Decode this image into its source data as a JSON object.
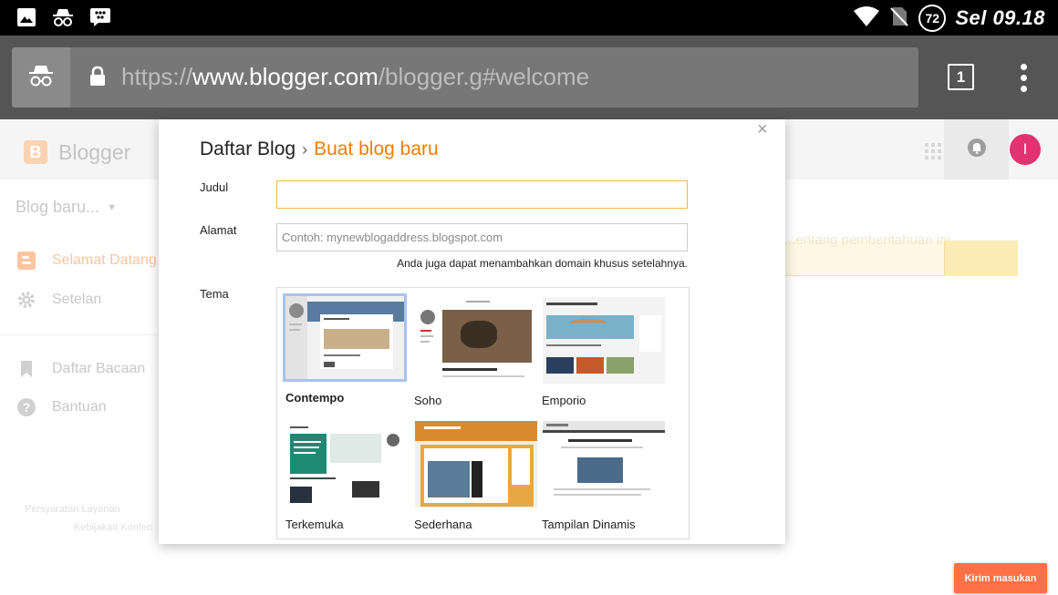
{
  "status_bar": {
    "battery": "72",
    "time": "Sel 09.18"
  },
  "browser": {
    "url_scheme": "https://",
    "url_host": "www.blogger.com",
    "url_path": "/blogger.g#welcome",
    "tab_count": "1"
  },
  "app": {
    "title": "Blogger",
    "avatar_initial": "I",
    "blog_select": "Blog baru...",
    "nav": [
      {
        "label": "Selamat Datang",
        "icon": "blogger-icon"
      },
      {
        "label": "Setelan",
        "icon": "gear-icon"
      },
      {
        "label": "Daftar Bacaan",
        "icon": "bookmark-icon"
      },
      {
        "label": "Bantuan",
        "icon": "help-icon"
      }
    ],
    "notice_text": "...entang pemberitahuan ini",
    "footer_links": [
      "Persyaratan Layanan",
      "Kebijakan Konten"
    ],
    "send_feedback": "Kirim masukan"
  },
  "dialog": {
    "breadcrumb_parent": "Daftar Blog",
    "breadcrumb_current": "Buat blog baru",
    "close": "×",
    "title_label": "Judul",
    "title_value": "",
    "address_label": "Alamat",
    "address_placeholder": "Contoh: mynewblogaddress.blogspot.com",
    "domain_hint": "Anda juga dapat menambahkan domain khusus setelahnya.",
    "theme_label": "Tema",
    "themes": [
      {
        "name": "Contempo",
        "selected": true
      },
      {
        "name": "Soho",
        "selected": false
      },
      {
        "name": "Emporio",
        "selected": false
      },
      {
        "name": "Terkemuka",
        "selected": false
      },
      {
        "name": "Sederhana",
        "selected": false
      },
      {
        "name": "Tampilan Dinamis",
        "selected": false
      }
    ]
  },
  "colors": {
    "accent_orange": "#f57d00",
    "input_focus": "#f2b64b",
    "feedback_button": "#ff7044",
    "avatar": "#e2326f",
    "selected_theme_border": "#a9c3ee"
  }
}
